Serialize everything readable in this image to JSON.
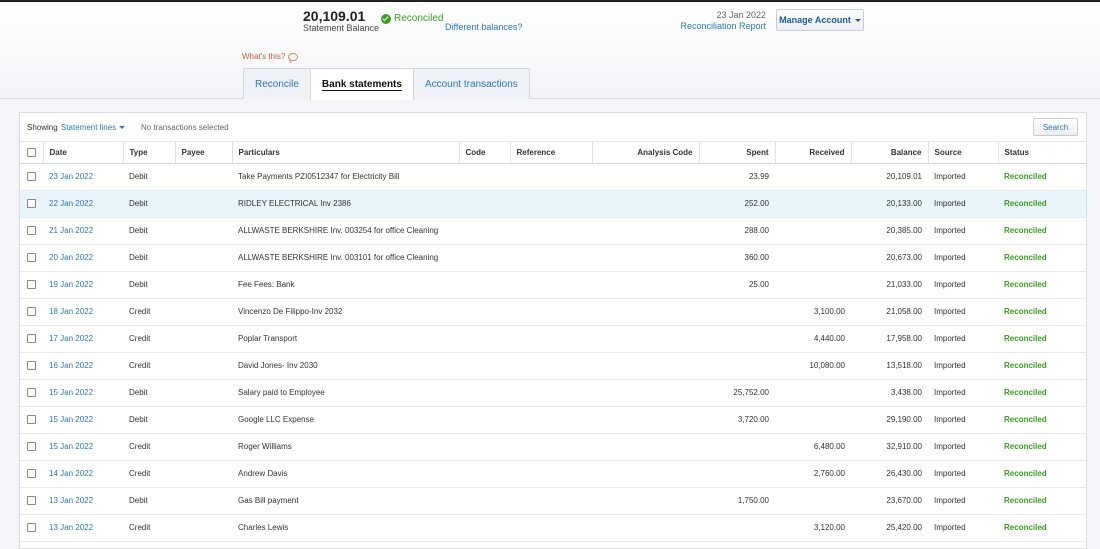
{
  "statement": {
    "balance": "20,109.01",
    "balance_label": "Statement Balance",
    "status": "Reconciled",
    "different_balances": "Different balances?"
  },
  "report": {
    "date": "23 Jan 2022",
    "link": "Reconciliation Report"
  },
  "manage_account": "Manage Account",
  "whats_this": "What's this?",
  "tabs": [
    {
      "label": "Reconcile",
      "active": false
    },
    {
      "label": "Bank statements",
      "active": true
    },
    {
      "label": "Account transactions",
      "active": false
    }
  ],
  "toolbar": {
    "showing": "Showing",
    "filter": "Statement lines",
    "selection": "No transactions selected",
    "search": "Search"
  },
  "columns": [
    "Date",
    "Type",
    "Payee",
    "Particulars",
    "Code",
    "Reference",
    "Analysis Code",
    "Spent",
    "Received",
    "Balance",
    "Source",
    "Status"
  ],
  "rows": [
    {
      "date": "23 Jan 2022",
      "type": "Debit",
      "payee": "",
      "particulars": "Take Payments PZI0512347 for Electricity Bill",
      "code": "",
      "reference": "",
      "analysis": "",
      "spent": "23.99",
      "received": "",
      "balance": "20,109.01",
      "source": "Imported",
      "status": "Reconciled"
    },
    {
      "date": "22 Jan 2022",
      "type": "Debit",
      "payee": "",
      "particulars": "RIDLEY ELECTRICAL Inv 2386",
      "code": "",
      "reference": "",
      "analysis": "",
      "spent": "252.00",
      "received": "",
      "balance": "20,133.00",
      "source": "Imported",
      "status": "Reconciled"
    },
    {
      "date": "21 Jan 2022",
      "type": "Debit",
      "payee": "",
      "particulars": "ALLWASTE BERKSHIRE Inv. 003254 for office Cleaning",
      "code": "",
      "reference": "",
      "analysis": "",
      "spent": "288.00",
      "received": "",
      "balance": "20,385.00",
      "source": "Imported",
      "status": "Reconciled"
    },
    {
      "date": "20 Jan 2022",
      "type": "Debit",
      "payee": "",
      "particulars": "ALLWASTE BERKSHIRE Inv. 003101 for office Cleaning",
      "code": "",
      "reference": "",
      "analysis": "",
      "spent": "360.00",
      "received": "",
      "balance": "20,673.00",
      "source": "Imported",
      "status": "Reconciled"
    },
    {
      "date": "19 Jan 2022",
      "type": "Debit",
      "payee": "",
      "particulars": "Fee Fees: Bank",
      "code": "",
      "reference": "",
      "analysis": "",
      "spent": "25.00",
      "received": "",
      "balance": "21,033.00",
      "source": "Imported",
      "status": "Reconciled"
    },
    {
      "date": "18 Jan 2022",
      "type": "Credit",
      "payee": "",
      "particulars": "Vincenzo De Filippo-Inv 2032",
      "code": "",
      "reference": "",
      "analysis": "",
      "spent": "",
      "received": "3,100.00",
      "balance": "21,058.00",
      "source": "Imported",
      "status": "Reconciled"
    },
    {
      "date": "17 Jan 2022",
      "type": "Credit",
      "payee": "",
      "particulars": "Poplar Transport",
      "code": "",
      "reference": "",
      "analysis": "",
      "spent": "",
      "received": "4,440.00",
      "balance": "17,958.00",
      "source": "Imported",
      "status": "Reconciled"
    },
    {
      "date": "16 Jan 2022",
      "type": "Credit",
      "payee": "",
      "particulars": "David Jones- Inv 2030",
      "code": "",
      "reference": "",
      "analysis": "",
      "spent": "",
      "received": "10,080.00",
      "balance": "13,518.00",
      "source": "Imported",
      "status": "Reconciled"
    },
    {
      "date": "15 Jan 2022",
      "type": "Debit",
      "payee": "",
      "particulars": "Salary paid to Employee",
      "code": "",
      "reference": "",
      "analysis": "",
      "spent": "25,752.00",
      "received": "",
      "balance": "3,438.00",
      "source": "Imported",
      "status": "Reconciled"
    },
    {
      "date": "15 Jan 2022",
      "type": "Debit",
      "payee": "",
      "particulars": "Google LLC Expense",
      "code": "",
      "reference": "",
      "analysis": "",
      "spent": "3,720.00",
      "received": "",
      "balance": "29,190.00",
      "source": "Imported",
      "status": "Reconciled"
    },
    {
      "date": "15 Jan 2022",
      "type": "Credit",
      "payee": "",
      "particulars": "Roger Williams",
      "code": "",
      "reference": "",
      "analysis": "",
      "spent": "",
      "received": "6,480.00",
      "balance": "32,910.00",
      "source": "Imported",
      "status": "Reconciled"
    },
    {
      "date": "14 Jan 2022",
      "type": "Credit",
      "payee": "",
      "particulars": "Andrew Davis",
      "code": "",
      "reference": "",
      "analysis": "",
      "spent": "",
      "received": "2,760.00",
      "balance": "26,430.00",
      "source": "Imported",
      "status": "Reconciled"
    },
    {
      "date": "13 Jan 2022",
      "type": "Debit",
      "payee": "",
      "particulars": "Gas Bill payment",
      "code": "",
      "reference": "",
      "analysis": "",
      "spent": "1,750.00",
      "received": "",
      "balance": "23,670.00",
      "source": "Imported",
      "status": "Reconciled"
    },
    {
      "date": "13 Jan 2022",
      "type": "Credit",
      "payee": "",
      "particulars": "Charles Lewis",
      "code": "",
      "reference": "",
      "analysis": "",
      "spent": "",
      "received": "3,120.00",
      "balance": "25,420.00",
      "source": "Imported",
      "status": "Reconciled"
    }
  ],
  "colors": {
    "link": "#2e77bb",
    "reconciled": "#3a9d23",
    "highlight_row": "#eaf4fb"
  }
}
